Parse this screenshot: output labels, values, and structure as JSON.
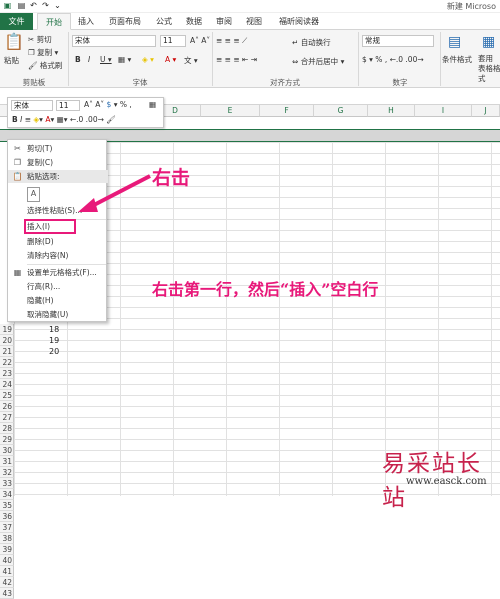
{
  "title": "新建 Microso",
  "tabs": [
    "文件",
    "开始",
    "插入",
    "页面布局",
    "公式",
    "数据",
    "审阅",
    "视图",
    "福昕阅读器"
  ],
  "clipboard": {
    "paste": "粘贴",
    "cut": "剪切",
    "copy": "复制",
    "format_painter": "格式刷",
    "label": "剪贴板"
  },
  "font": {
    "name": "宋体",
    "size": "11",
    "label": "字体"
  },
  "align": {
    "wrap": "自动换行",
    "merge": "合并后居中",
    "label": "对齐方式"
  },
  "number": {
    "format": "常规",
    "label": "数字"
  },
  "styles": {
    "cond": "条件格式",
    "table_label": "套用\n表格格式"
  },
  "mini_toolbar": {
    "font": "宋体",
    "size": "11"
  },
  "columns": [
    "D",
    "E",
    "F",
    "G",
    "H",
    "I",
    "J"
  ],
  "rows": [
    {
      "n": "19",
      "v": "18"
    },
    {
      "n": "20",
      "v": "19"
    },
    {
      "n": "21",
      "v": "20"
    },
    {
      "n": "22",
      "v": ""
    },
    {
      "n": "23",
      "v": ""
    },
    {
      "n": "24",
      "v": ""
    },
    {
      "n": "25",
      "v": ""
    },
    {
      "n": "26",
      "v": ""
    },
    {
      "n": "27",
      "v": ""
    },
    {
      "n": "28",
      "v": ""
    },
    {
      "n": "29",
      "v": ""
    },
    {
      "n": "30",
      "v": ""
    },
    {
      "n": "31",
      "v": ""
    },
    {
      "n": "32",
      "v": ""
    },
    {
      "n": "33",
      "v": ""
    },
    {
      "n": "34",
      "v": ""
    },
    {
      "n": "35",
      "v": ""
    },
    {
      "n": "36",
      "v": ""
    },
    {
      "n": "37",
      "v": ""
    },
    {
      "n": "38",
      "v": ""
    },
    {
      "n": "39",
      "v": ""
    },
    {
      "n": "40",
      "v": ""
    },
    {
      "n": "41",
      "v": ""
    },
    {
      "n": "42",
      "v": ""
    },
    {
      "n": "43",
      "v": ""
    }
  ],
  "context_menu": {
    "cut": "剪切(T)",
    "copy": "复制(C)",
    "paste_options": "粘贴选项:",
    "paste_special": "选择性粘贴(S)...",
    "insert": "插入(I)",
    "delete": "删除(D)",
    "clear": "清除内容(N)",
    "format_cells": "设置单元格格式(F)...",
    "row_height": "行高(R)...",
    "hide": "隐藏(H)",
    "unhide": "取消隐藏(U)"
  },
  "annotations": {
    "right_click": "右击",
    "instruction": "右击第一行，然后“插入”空白行"
  },
  "watermark": {
    "cn": "易采站长站",
    "en": "www.easck.com"
  },
  "colors": {
    "accent": "#217346",
    "callout": "#e8197a",
    "highlight": "#e8197a"
  }
}
